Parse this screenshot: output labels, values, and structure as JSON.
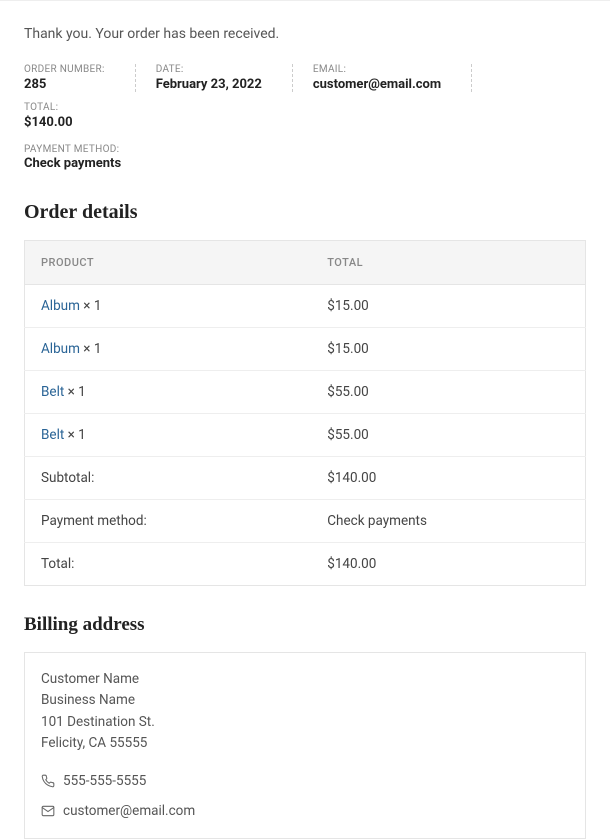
{
  "thank_you_message": "Thank you. Your order has been received.",
  "meta": {
    "order_number_label": "ORDER NUMBER:",
    "order_number": "285",
    "date_label": "DATE:",
    "date": "February 23, 2022",
    "email_label": "EMAIL:",
    "email": "customer@email.com",
    "total_label": "TOTAL:",
    "total": "$140.00",
    "payment_method_label": "PAYMENT METHOD:",
    "payment_method": "Check payments"
  },
  "order_details_heading": "Order details",
  "table": {
    "header_product": "PRODUCT",
    "header_total": "TOTAL",
    "items": [
      {
        "name": "Album",
        "qty": " × 1",
        "total": "$15.00"
      },
      {
        "name": "Album",
        "qty": " × 1",
        "total": "$15.00"
      },
      {
        "name": "Belt",
        "qty": " × 1",
        "total": "$55.00"
      },
      {
        "name": "Belt",
        "qty": " × 1",
        "total": "$55.00"
      }
    ],
    "subtotal_label": "Subtotal:",
    "subtotal_value": "$140.00",
    "payment_method_label": "Payment method:",
    "payment_method_value": "Check payments",
    "total_label": "Total:",
    "total_value": "$140.00"
  },
  "billing_heading": "Billing address",
  "billing": {
    "name": "Customer Name",
    "company": "Business Name",
    "street": "101 Destination St.",
    "city_state_zip": "Felicity, CA 55555",
    "phone": "555-555-5555",
    "email": "customer@email.com"
  }
}
